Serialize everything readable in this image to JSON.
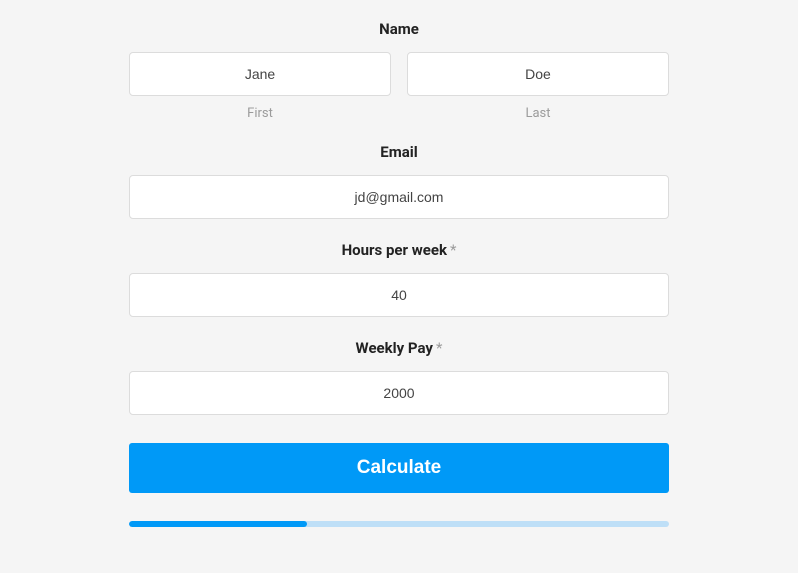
{
  "fields": {
    "name": {
      "label": "Name",
      "first_value": "Jane",
      "last_value": "Doe",
      "first_sublabel": "First",
      "last_sublabel": "Last"
    },
    "email": {
      "label": "Email",
      "value": "jd@gmail.com"
    },
    "hours": {
      "label": "Hours per week",
      "required_mark": "*",
      "value": "40"
    },
    "pay": {
      "label": "Weekly Pay",
      "required_mark": "*",
      "value": "2000"
    }
  },
  "button": {
    "calculate": "Calculate"
  },
  "progress": {
    "percent": 33
  }
}
